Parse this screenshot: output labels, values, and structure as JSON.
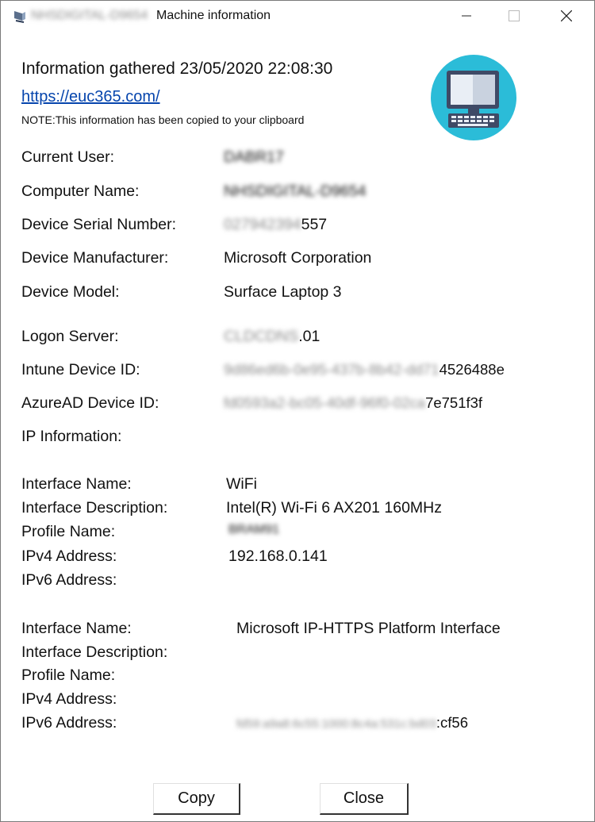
{
  "window": {
    "title_hidden": "NHSDIGITAL-D9654",
    "title": "Machine information",
    "controls": {
      "minimize_icon": "minimize-icon",
      "maximize_icon": "maximize-icon",
      "close_icon": "close-icon"
    }
  },
  "header": {
    "gathered": "Information gathered 23/05/2020 22:08:30",
    "url": "https://euc365.com/",
    "note": "NOTE:This information has been copied to your clipboard",
    "graphic_icon": "computer-icon"
  },
  "fields": {
    "current_user": {
      "label": "Current User:",
      "value_hidden": "DABR17"
    },
    "computer_name": {
      "label": "Computer Name:",
      "value_hidden": "NHSDIGITAL-D9654"
    },
    "serial": {
      "label": "Device Serial Number:",
      "value_hidden": "027942394",
      "value_visible": "557"
    },
    "manufacturer": {
      "label": "Device Manufacturer:",
      "value": "Microsoft Corporation"
    },
    "model": {
      "label": "Device Model:",
      "value": "Surface Laptop 3"
    },
    "logon_server": {
      "label": "Logon Server:",
      "value_hidden": "CLDCDNS",
      "value_visible": ".01"
    },
    "intune_id": {
      "label": "Intune Device ID:",
      "value_hidden": "9d86ed6b-0e95-437b-8b42-dd71",
      "value_visible": "4526488e"
    },
    "azuread_id": {
      "label": "AzureAD Device ID:",
      "value_hidden": "fd0593a2-bc05-40df-96f0-02ca",
      "value_visible": "7e751f3f"
    },
    "ip_info": {
      "label": "IP Information:"
    }
  },
  "interfaces": [
    {
      "name_label": "Interface Name:",
      "name_value": "WiFi",
      "desc_label": "Interface Description:",
      "desc_value": "Intel(R) Wi-Fi 6 AX201 160MHz",
      "profile_label": "Profile Name:",
      "profile_hidden": "BRAM91",
      "ipv4_label": "IPv4 Address:",
      "ipv4_value": "192.168.0.141",
      "ipv6_label": "IPv6 Address:"
    },
    {
      "name_label": "Interface Name:",
      "name_value": "Microsoft IP-HTTPS Platform Interface",
      "desc_label": "Interface Description:",
      "profile_label": "Profile Name:",
      "ipv4_label": "IPv4 Address:",
      "ipv6_label": "IPv6 Address:",
      "ipv6_hidden": "fd59:a9a8:6c55:1000:8c4a:531c:bd03",
      "ipv6_visible": ":cf56"
    }
  ],
  "buttons": {
    "copy": "Copy",
    "close": "Close"
  },
  "colors": {
    "link": "#0645ad",
    "icon_circle": "#2bbcd8",
    "monitor": "#3f4a66"
  }
}
